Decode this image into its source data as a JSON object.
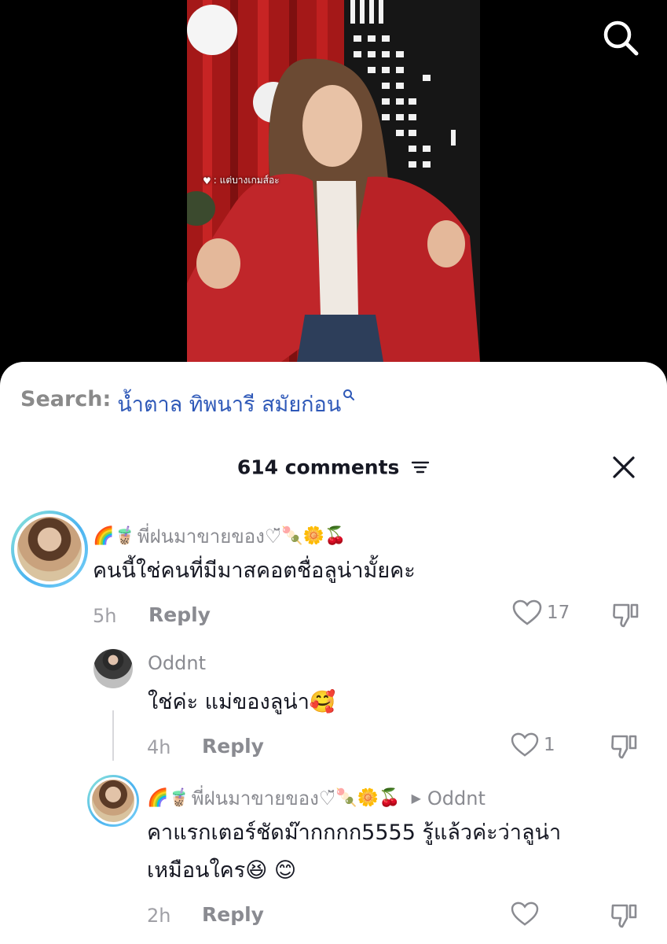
{
  "video": {
    "overlay_text": ": แต่บางเกมส์อะ"
  },
  "search_suggestion": {
    "prefix": "Search:",
    "query": "น้ำตาล ทิพนารี สมัยก่อน"
  },
  "comments_header": {
    "count_label": "614 comments"
  },
  "comments": [
    {
      "username": "พี่ฝนมาขายของ♡̆̈",
      "username_emoji_before": "🌈🧋",
      "username_emoji_after": "🍡🌼🍒",
      "text": "คนนี้ใช่คนที่มีมาสคอตชื่อลูน่ามั้ยคะ",
      "time": "5h",
      "reply_label": "Reply",
      "likes": "17"
    },
    {
      "username": "Oddnt",
      "text": "ใช่ค่ะ แม่ของลูน่า🥰",
      "time": "4h",
      "reply_label": "Reply",
      "likes": "1"
    },
    {
      "username": "พี่ฝนมาขายของ♡̆̈",
      "username_emoji_before": "🌈🧋",
      "username_emoji_after": "🍡🌼🍒",
      "reply_to": "Oddnt",
      "text_line1": "คาแรกเตอร์ชัดม๊ากกกก5555 รู้แล้วค่ะว่าลูน่า",
      "text_line2": "เหมือนใคร😆 😊",
      "time": "2h",
      "reply_label": "Reply"
    }
  ],
  "icons": {
    "search": "search-icon",
    "filter": "filter-icon",
    "close": "close-icon",
    "heart": "heart-icon",
    "dislike": "thumbs-down-icon"
  },
  "colors": {
    "search_query": "#2f59b8",
    "muted_text": "#8a8b91",
    "primary_text": "#161823",
    "sheet_bg": "#ffffff"
  }
}
